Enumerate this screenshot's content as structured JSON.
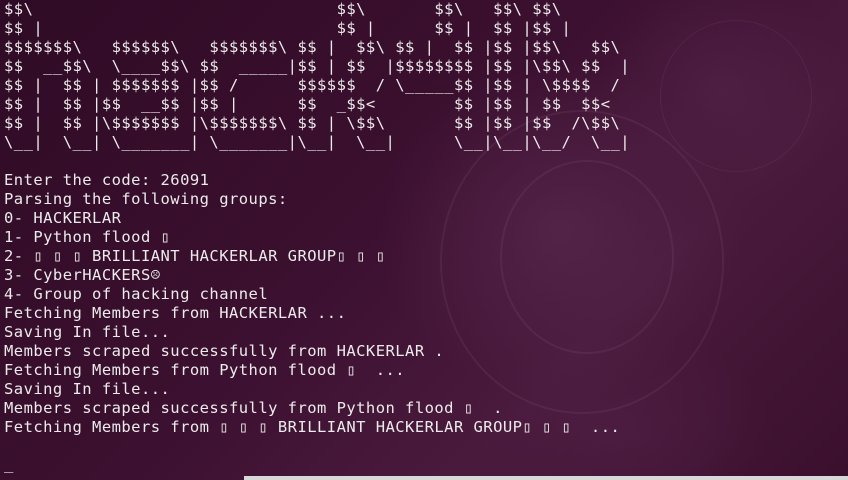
{
  "colors": {
    "background": "#3a0f2c",
    "text": "#ebebeb",
    "scrollbar": "#d8d8d8"
  },
  "banner": [
    "$$\\                               $$\\       $$\\   $$\\ $$\\",
    "$$ |                              $$ |      $$ |  $$ |$$ |",
    "$$$$$$$\\   $$$$$$\\   $$$$$$$\\ $$ |  $$\\ $$ |  $$ |$$ |$$\\   $$\\",
    "$$  __$$\\  \\____$$\\ $$  _____|$$ | $$  |$$$$$$$$ |$$ |\\$$\\ $$  |",
    "$$ |  $$ | $$$$$$$ |$$ /      $$$$$$  / \\_____$$ |$$ | \\$$$$  /",
    "$$ |  $$ |$$  __$$ |$$ |      $$  _$$<        $$ |$$ | $$  $$<",
    "$$ |  $$ |\\$$$$$$$ |\\$$$$$$$\\ $$ | \\$$\\       $$ |$$ |$$  /\\$$\\",
    "\\__|  \\__| \\_______| \\_______|\\__|  \\__|      \\__|\\__|\\__/  \\__|"
  ],
  "output": [
    "",
    "Enter the code: 26091",
    "Parsing the following groups:",
    "0- HACKERLAR",
    "1- Python flood ▯",
    "2- ▯ ▯ ▯ BRILLIANT HACKERLAR GROUP▯ ▯ ▯",
    "3- CyberHACKERS☹",
    "4- Group of hacking channel",
    "Fetching Members from HACKERLAR ...",
    "Saving In file...",
    "Members scraped successfully from HACKERLAR .",
    "Fetching Members from Python flood ▯  ...",
    "Saving In file...",
    "Members scraped successfully from Python flood ▯  .",
    "Fetching Members from ▯ ▯ ▯ BRILLIANT HACKERLAR GROUP▯ ▯ ▯  ..."
  ],
  "cursor": "_"
}
